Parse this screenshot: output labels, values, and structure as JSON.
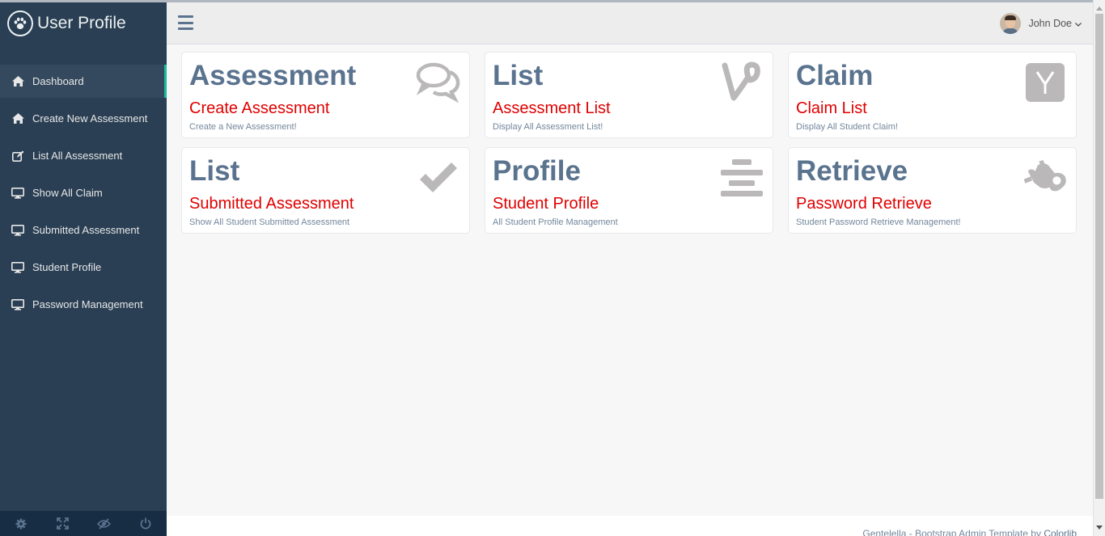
{
  "brand": {
    "title": "User Profile",
    "icon": "paw-icon"
  },
  "sidebar": {
    "items": [
      {
        "label": "Dashboard",
        "icon": "home-icon",
        "active": true
      },
      {
        "label": "Create New Assessment",
        "icon": "home-icon"
      },
      {
        "label": "List All Assessment",
        "icon": "edit-icon"
      },
      {
        "label": "Show All Claim",
        "icon": "desktop-icon"
      },
      {
        "label": "Submitted Assessment",
        "icon": "desktop-icon"
      },
      {
        "label": "Student Profile",
        "icon": "desktop-icon"
      },
      {
        "label": "Password Management",
        "icon": "desktop-icon"
      }
    ],
    "footer_icons": [
      "gear-icon",
      "fullscreen-icon",
      "eye-slash-icon",
      "power-icon"
    ]
  },
  "topnav": {
    "user_name": "John Doe",
    "menu_icon": "hamburger-icon"
  },
  "tiles": [
    {
      "count": "Assessment",
      "heading": "Create Assessment",
      "desc": "Create a New Assessment!",
      "icon": "comments-icon"
    },
    {
      "count": "List",
      "heading": "Assessment List",
      "desc": "Display All Assessment List!",
      "icon": "vine-icon"
    },
    {
      "count": "Claim",
      "heading": "Claim List",
      "desc": "Display All Student Claim!",
      "icon": "y-combinator-icon"
    },
    {
      "count": "List",
      "heading": "Submitted Assessment",
      "desc": "Show All Student Submitted Assessment",
      "icon": "check-icon"
    },
    {
      "count": "Profile",
      "heading": "Student Profile",
      "desc": "All Student Profile Management",
      "icon": "align-center-icon"
    },
    {
      "count": "Retrieve",
      "heading": "Password Retrieve",
      "desc": "Student Password Retrieve Management!",
      "icon": "sign-language-icon"
    }
  ],
  "footer": {
    "text": "Gentelella - Bootstrap Admin Template by ",
    "link": "Colorlib"
  },
  "colors": {
    "sidebar": "#2A3F54",
    "accent": "#1ABB9C",
    "heading_red": "#E00000",
    "count_blue": "#5A738E"
  }
}
